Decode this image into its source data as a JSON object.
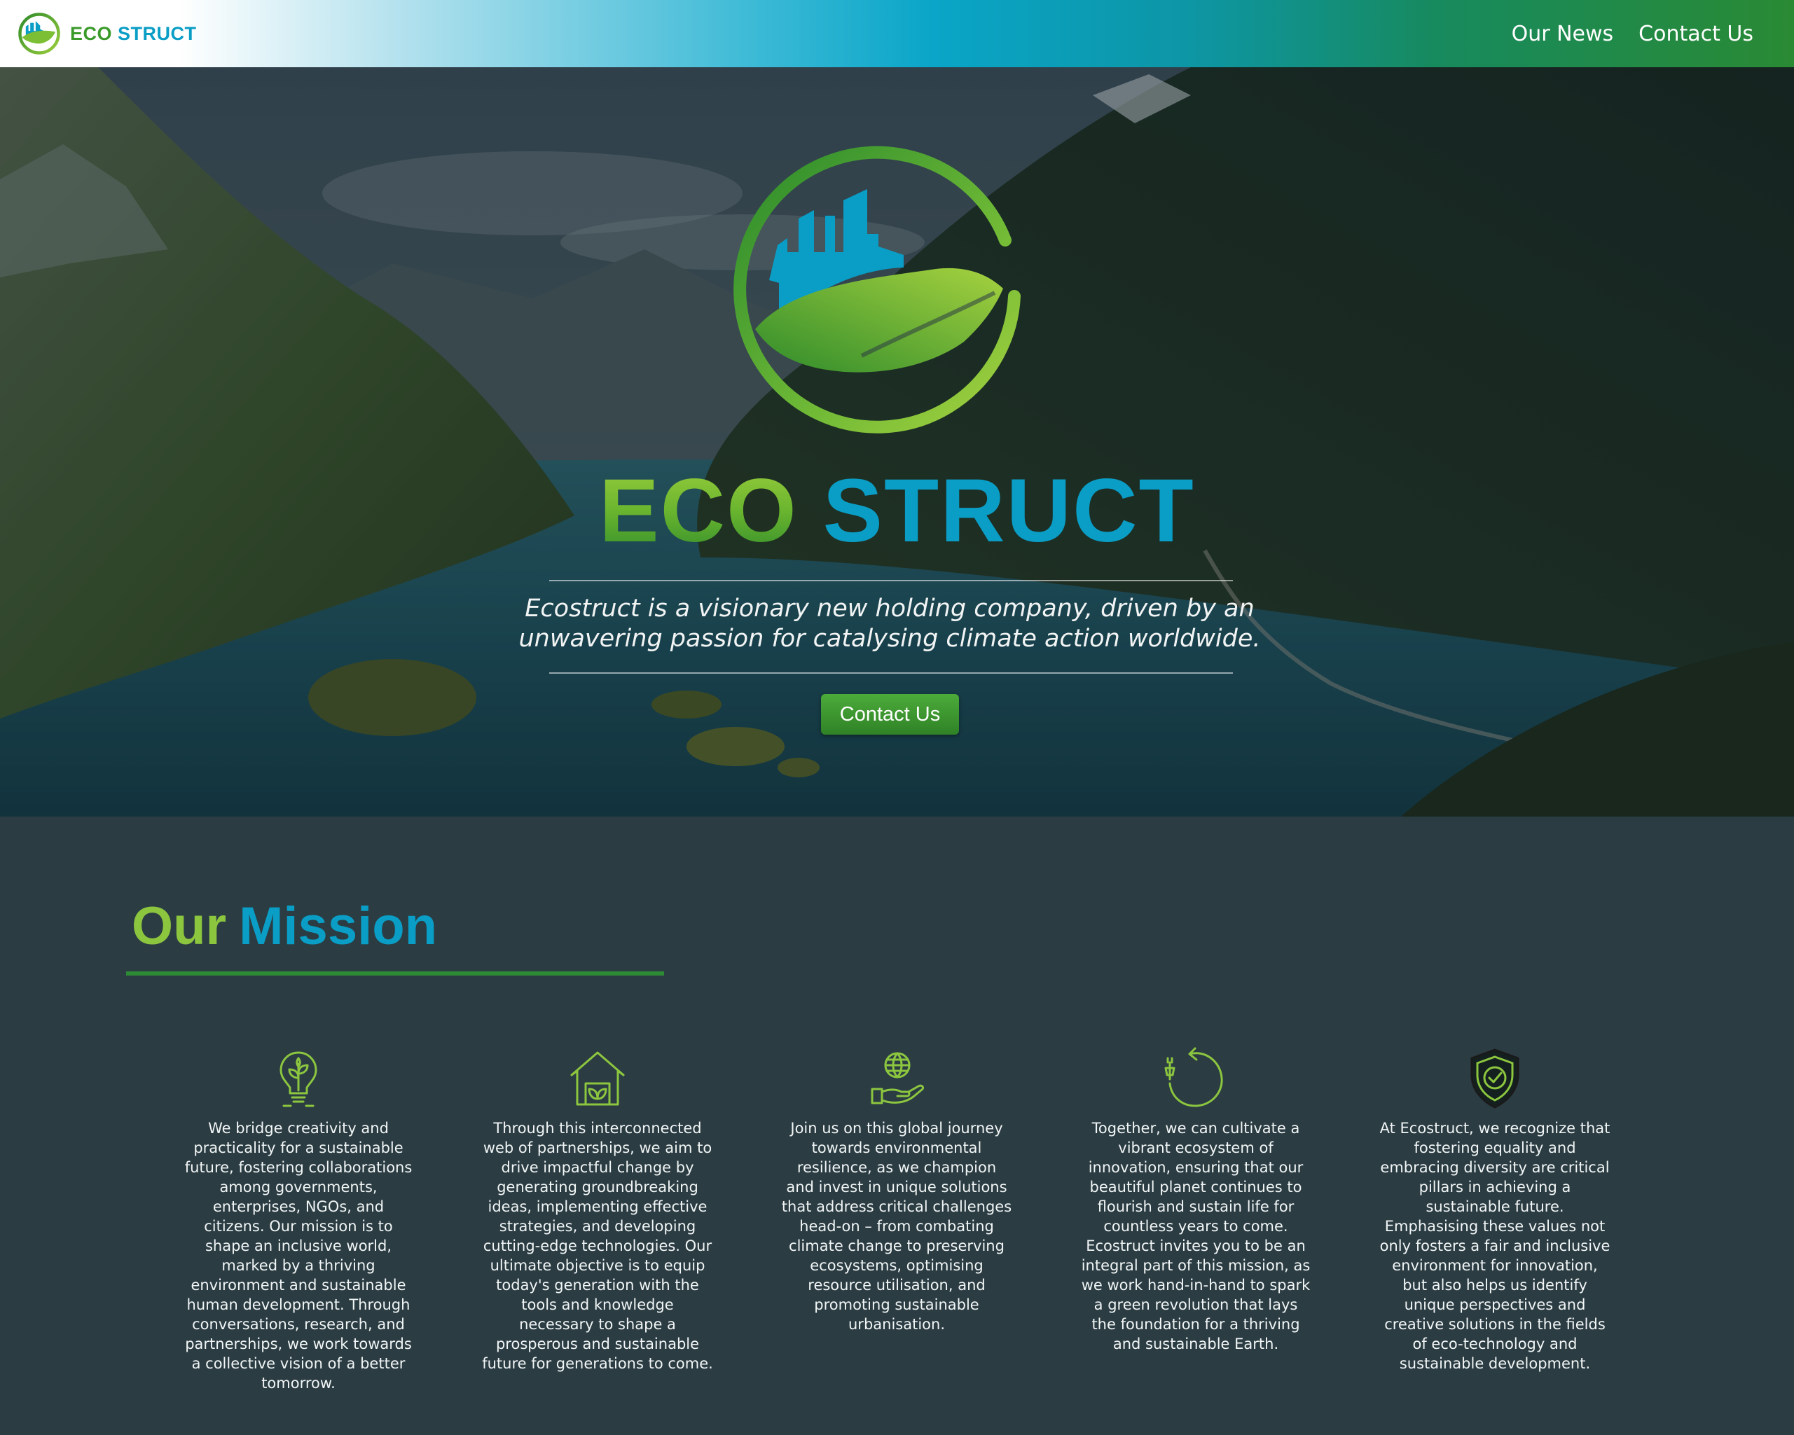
{
  "header": {
    "brand_eco": "ECO",
    "brand_struct": "STRUCT",
    "nav": [
      {
        "label": "Our News"
      },
      {
        "label": "Contact Us"
      }
    ]
  },
  "hero": {
    "title_eco": "ECO",
    "title_struct": "STRUCT",
    "tagline": "Ecostruct is a visionary new holding company, driven by an unwavering passion for catalysing climate action worldwide.",
    "cta_label": "Contact Us"
  },
  "mission": {
    "title_our": "Our",
    "title_mission": "Mission",
    "cards": [
      {
        "icon": "lightbulb-plant-icon",
        "text": "We bridge creativity and practicality for a sustainable future, fostering collaborations among governments, enterprises, NGOs, and citizens. Our mission is to shape an inclusive world, marked by a thriving environment and sustainable human development. Through conversations, research, and partnerships, we work towards a collective vision of a better tomorrow."
      },
      {
        "icon": "eco-house-icon",
        "text": "Through this interconnected web of partnerships, we aim to drive impactful change by generating groundbreaking ideas, implementing effective strategies, and developing cutting-edge technologies. Our ultimate objective is to equip today's generation with the tools and knowledge necessary to shape a prosperous and sustainable future for generations to come."
      },
      {
        "icon": "globe-in-hand-icon",
        "text": "Join us on this global journey towards environmental resilience, as we champion and invest in unique solutions that address critical challenges head-on – from combating climate change to preserving ecosystems, optimising resource utilisation, and promoting sustainable urbanisation."
      },
      {
        "icon": "renewable-cycle-icon",
        "text": "Together, we can cultivate a vibrant ecosystem of innovation, ensuring that our beautiful planet continues to flourish and sustain life for countless years to come. Ecostruct invites you to be an integral part of this mission, as we work hand-in-hand to spark a green revolution that lays the foundation for a thriving and sustainable Earth."
      },
      {
        "icon": "shield-check-icon",
        "text": "At Ecostruct, we recognize that fostering equality and embracing diversity are critical pillars in achieving a sustainable future. Emphasising these values not only fosters a fair and inclusive environment for innovation, but also helps us identify unique perspectives and creative solutions in the fields of eco-technology and sustainable development."
      }
    ]
  },
  "colors": {
    "brand_green": "#8cc63f",
    "brand_dark_green": "#2d8a35",
    "brand_blue": "#0a9dc5",
    "section_bg": "#2b3c43"
  }
}
